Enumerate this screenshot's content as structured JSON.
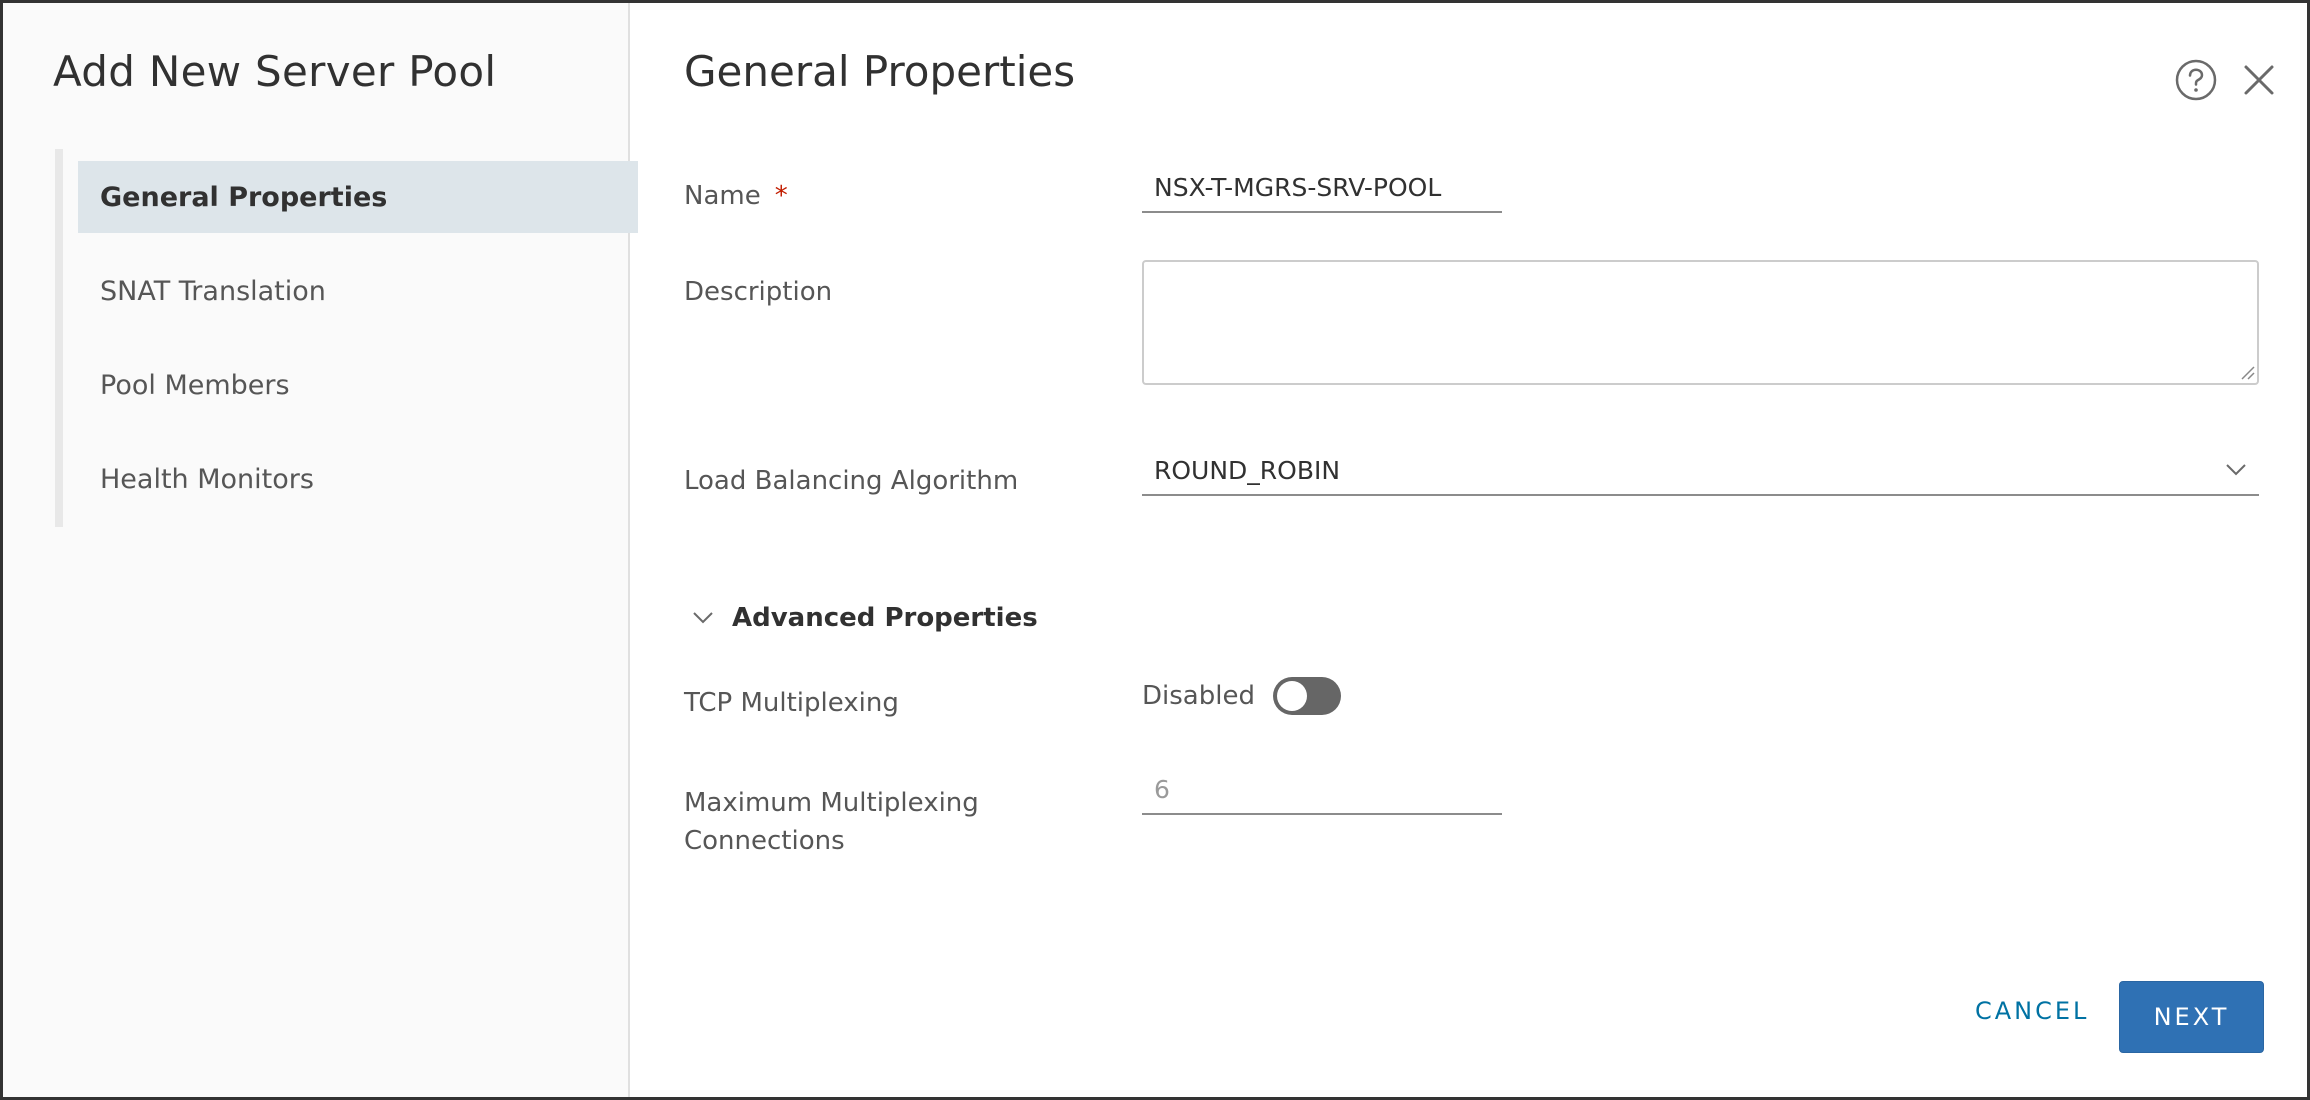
{
  "wizard": {
    "title": "Add New Server Pool",
    "steps": [
      {
        "label": "General Properties",
        "active": true
      },
      {
        "label": "SNAT Translation",
        "active": false
      },
      {
        "label": "Pool Members",
        "active": false
      },
      {
        "label": "Health Monitors",
        "active": false
      }
    ]
  },
  "form": {
    "title": "General Properties",
    "name": {
      "label": "Name",
      "required_mark": "*",
      "value": "NSX-T-MGRS-SRV-POOL"
    },
    "description": {
      "label": "Description",
      "value": ""
    },
    "algorithm": {
      "label": "Load Balancing Algorithm",
      "value": "ROUND_ROBIN"
    },
    "advanced": {
      "label": "Advanced Properties",
      "expanded": true
    },
    "tcp_multiplexing": {
      "label": "TCP Multiplexing",
      "state_label": "Disabled",
      "enabled": false
    },
    "max_multiplexing": {
      "label_line1": "Maximum Multiplexing",
      "label_line2": "Connections",
      "value": "6"
    }
  },
  "footer": {
    "cancel_label": "CANCEL",
    "next_label": "NEXT"
  },
  "icons": {
    "help": "help-circle-icon",
    "close": "close-icon",
    "select": "chevron-down-icon",
    "advanced": "chevron-down-icon"
  },
  "colors": {
    "primary": "#2f71b4",
    "link": "#0072a3",
    "required": "#c21d00",
    "active_step": "#dde5ea",
    "switch_off": "#666666"
  }
}
